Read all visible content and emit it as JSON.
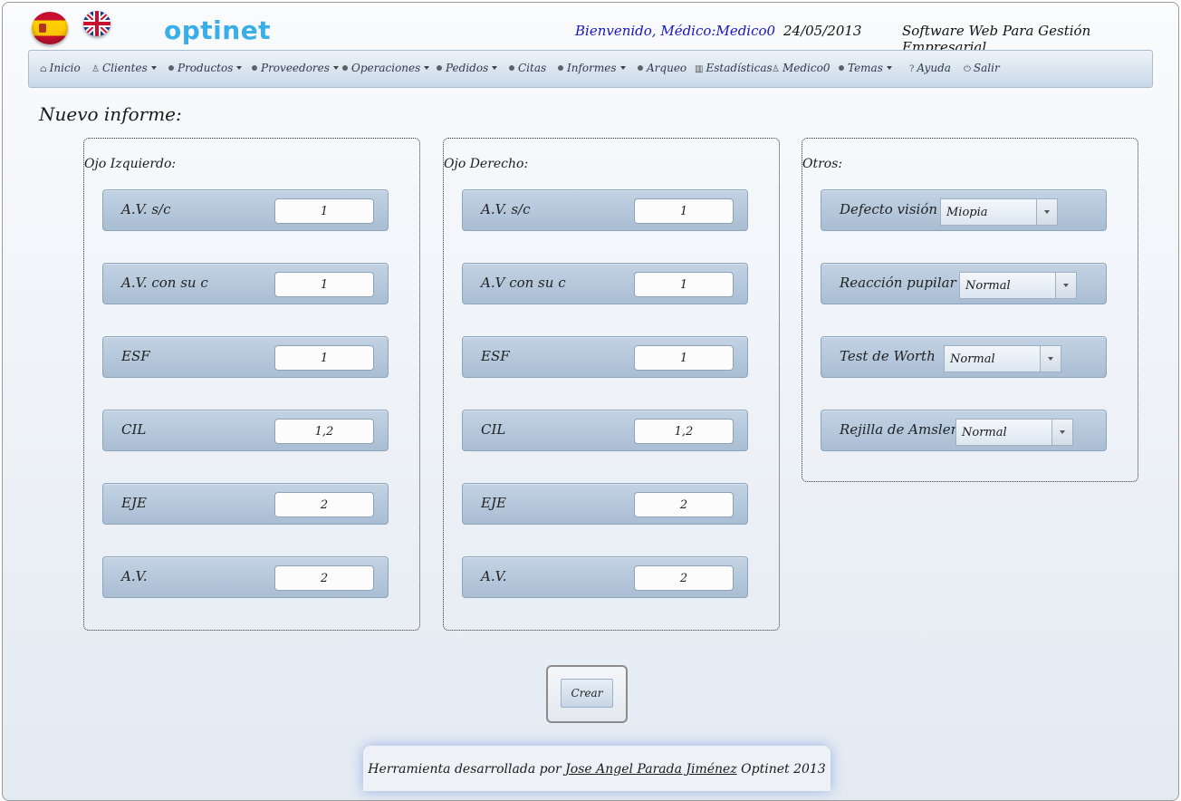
{
  "header": {
    "logo_text": "optinet",
    "welcome": "Bienvenido, Médico:Medico0",
    "date": "24/05/2013",
    "tagline": "Software Web Para Gestión Empresarial."
  },
  "nav": {
    "inicio": "Inicio",
    "clientes": "Clientes",
    "productos": "Productos",
    "proveedores": "Proveedores",
    "operaciones": "Operaciones",
    "pedidos": "Pedidos",
    "citas": "Citas",
    "informes": "Informes",
    "arqueo": "Arqueo",
    "estadisticas": "Estadísticas",
    "usuario": "Medico0",
    "temas": "Temas",
    "ayuda": "Ayuda",
    "salir": "Salir"
  },
  "page": {
    "title": "Nuevo informe:"
  },
  "left_eye": {
    "label": "Ojo Izquierdo:",
    "fields": [
      {
        "label": "A.V. s/c",
        "value": "1"
      },
      {
        "label": "A.V. con su c",
        "value": "1"
      },
      {
        "label": "ESF",
        "value": "1"
      },
      {
        "label": "CIL",
        "value": "1,2"
      },
      {
        "label": "EJE",
        "value": "2"
      },
      {
        "label": "A.V.",
        "value": "2"
      }
    ]
  },
  "right_eye": {
    "label": "Ojo Derecho:",
    "fields": [
      {
        "label": "A.V. s/c",
        "value": "1"
      },
      {
        "label": "A.V con su c",
        "value": "1"
      },
      {
        "label": "ESF",
        "value": "1"
      },
      {
        "label": "CIL",
        "value": "1,2"
      },
      {
        "label": "EJE",
        "value": "2"
      },
      {
        "label": "A.V.",
        "value": "2"
      }
    ]
  },
  "others": {
    "label": "Otros:",
    "fields": [
      {
        "label": "Defecto visión",
        "value": "Miopia"
      },
      {
        "label": "Reacción pupilar",
        "value": "Normal"
      },
      {
        "label": "Test de Worth",
        "value": "Normal"
      },
      {
        "label": "Rejilla de Amsler",
        "value": "Normal"
      }
    ]
  },
  "actions": {
    "create_label": "Crear"
  },
  "footer": {
    "prefix": "Herramienta desarrollada por",
    "author": "Jose Angel Parada Jiménez",
    "suffix": "Optinet 2013"
  },
  "icons": {
    "flag_es": "spain-flag-icon",
    "flag_uk": "uk-flag-icon",
    "home": "home-icon",
    "user": "user-icon",
    "chart": "chart-icon",
    "help": "help-icon",
    "power": "power-icon"
  }
}
